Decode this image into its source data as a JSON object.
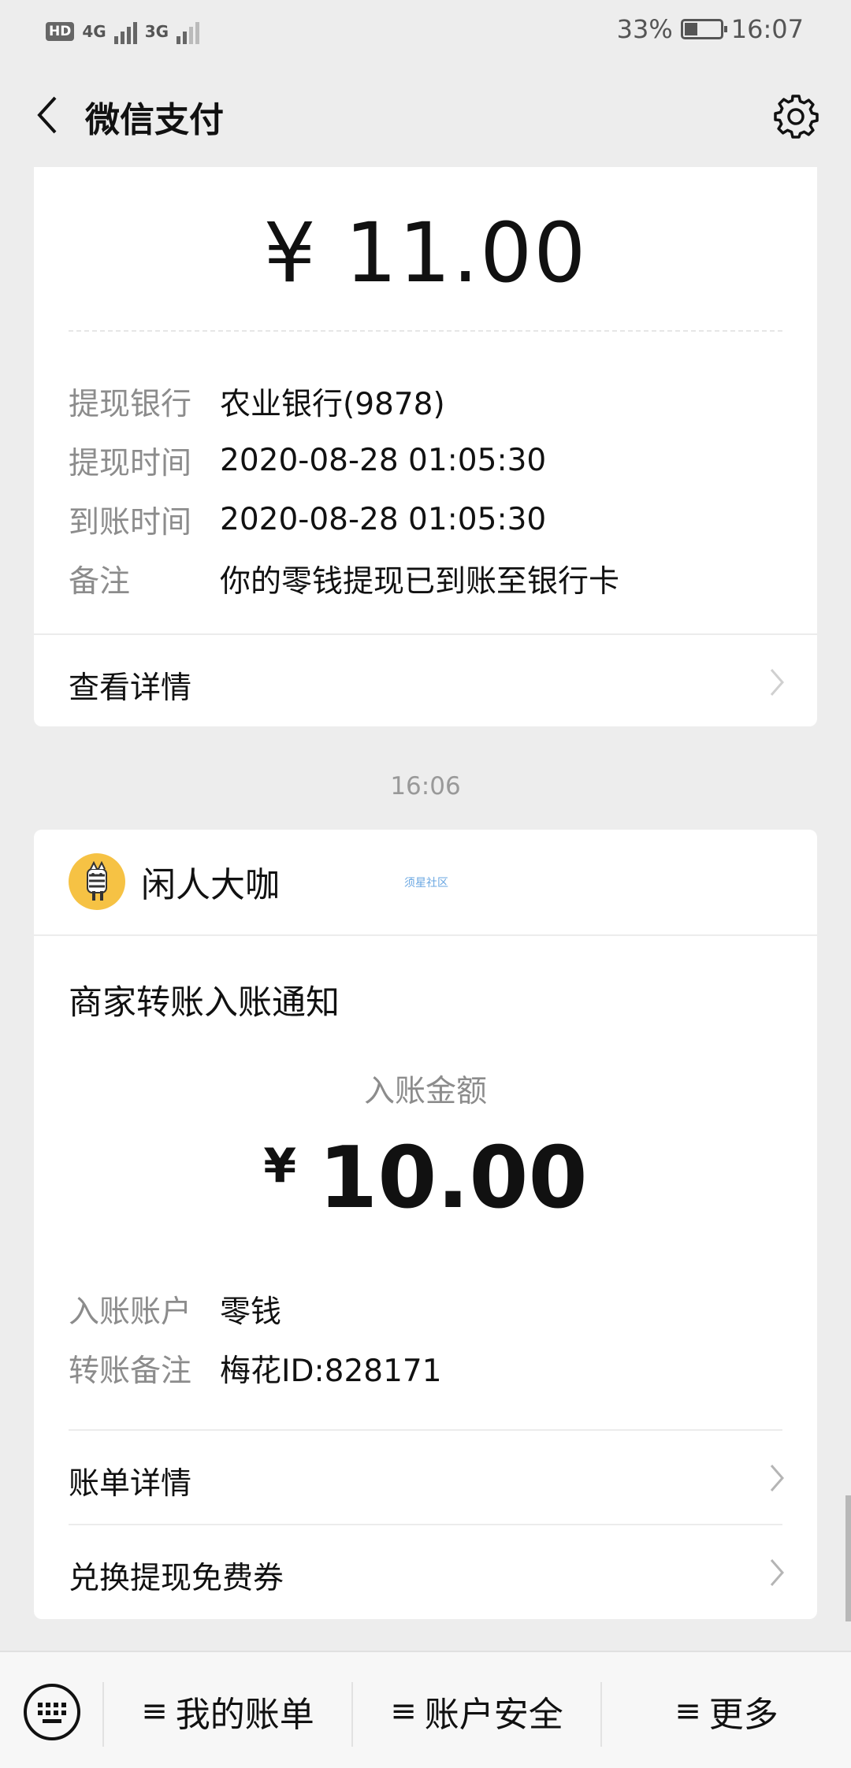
{
  "statusbar": {
    "hd": "HD",
    "net1": "4G",
    "net2": "3G",
    "battery_pct": "33%",
    "time": "16:07"
  },
  "nav": {
    "title": "微信支付",
    "back_icon": "chevron-left-icon",
    "settings_icon": "gear-icon"
  },
  "withdraw_card": {
    "amount": "¥ 11.00",
    "rows": [
      {
        "key": "提现银行",
        "value": "农业银行(9878)"
      },
      {
        "key": "提现时间",
        "value": "2020-08-28 01:05:30"
      },
      {
        "key": "到账时间",
        "value": "2020-08-28 01:05:30"
      },
      {
        "key": "备注",
        "value": "你的零钱提现已到账至银行卡"
      }
    ],
    "details_link": "查看详情"
  },
  "timestamp": "16:06",
  "transfer_card": {
    "merchant_name": "闲人大咖",
    "watermark": "须星社区",
    "notice_title": "商家转账入账通知",
    "amount_label": "入账金额",
    "currency": "¥",
    "amount": "10.00",
    "rows": [
      {
        "key": "入账账户",
        "value": "零钱"
      },
      {
        "key": "转账备注",
        "value": "梅花ID:828171"
      }
    ],
    "links": [
      "账单详情",
      "兑换提现免费券"
    ]
  },
  "bottom_menu": {
    "keyboard_icon": "keyboard-icon",
    "items": [
      "我的账单",
      "账户安全",
      "更多"
    ],
    "menu_glyph": "≡"
  },
  "colors": {
    "background": "#ededed",
    "card": "#ffffff",
    "secondary_text": "#8c8c8c",
    "avatar_bg": "#f6c244"
  }
}
